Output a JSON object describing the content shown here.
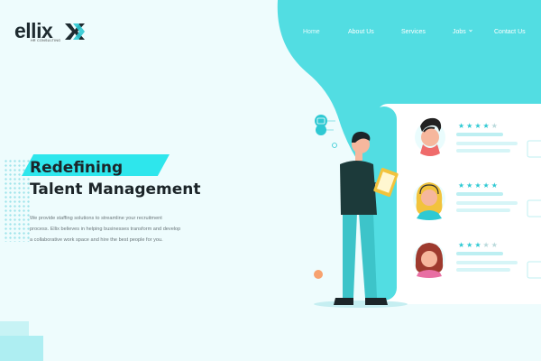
{
  "brand": {
    "name": "ellix",
    "tagline": "HR CONSULTING",
    "accent": "#2ee6ec",
    "teal": "#52dde2",
    "dark": "#1c2529"
  },
  "nav": {
    "items": [
      {
        "label": "Home",
        "active": true
      },
      {
        "label": "About Us"
      },
      {
        "label": "Services"
      },
      {
        "label": "Jobs"
      },
      {
        "label": "Contact Us"
      }
    ]
  },
  "hero": {
    "title_line1": "Redefining",
    "title_line2": "Talent Management",
    "desc_line1": "We provide staffing solutions to streamline your recruitment",
    "desc_line2": "process. Ellix believes in helping businesses transform and develop",
    "desc_line3": "a collaborative work space and hire the best people for you."
  },
  "candidates": [
    {
      "stars": 4,
      "max": 5,
      "icon": "man-avatar-icon"
    },
    {
      "stars": 5,
      "max": 5,
      "icon": "woman-headset-avatar-icon"
    },
    {
      "stars": 3,
      "max": 5,
      "icon": "woman-avatar-icon"
    }
  ]
}
